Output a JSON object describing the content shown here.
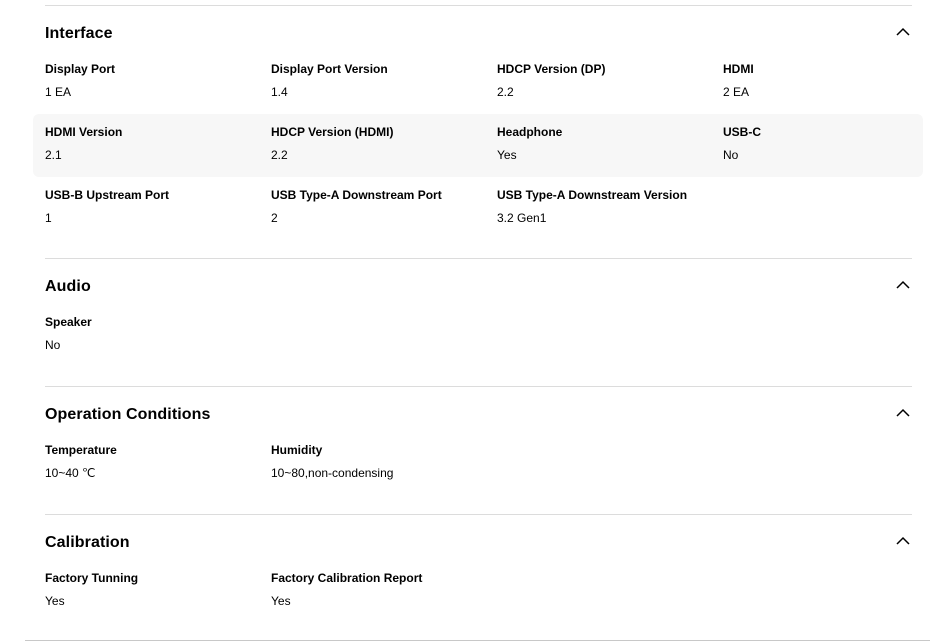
{
  "colors": {
    "divider": "#dcdcdc",
    "row_highlight": "#f7f7f7",
    "text": "#000000"
  },
  "sections": {
    "interface": {
      "title": "Interface",
      "toggle_icon": "chevron-up-icon",
      "rows": [
        [
          {
            "label": "Display Port",
            "value": "1 EA"
          },
          {
            "label": "Display Port Version",
            "value": "1.4"
          },
          {
            "label": "HDCP Version (DP)",
            "value": "2.2"
          },
          {
            "label": "HDMI",
            "value": "2 EA"
          }
        ],
        [
          {
            "label": "HDMI Version",
            "value": "2.1"
          },
          {
            "label": "HDCP Version (HDMI)",
            "value": "2.2"
          },
          {
            "label": "Headphone",
            "value": "Yes"
          },
          {
            "label": "USB-C",
            "value": "No"
          }
        ],
        [
          {
            "label": "USB-B Upstream Port",
            "value": "1"
          },
          {
            "label": "USB Type-A Downstream Port",
            "value": "2"
          },
          {
            "label": "USB Type-A Downstream Version",
            "value": "3.2 Gen1"
          }
        ]
      ]
    },
    "audio": {
      "title": "Audio",
      "toggle_icon": "chevron-up-icon",
      "rows": [
        [
          {
            "label": "Speaker",
            "value": "No"
          }
        ]
      ]
    },
    "operation": {
      "title": "Operation Conditions",
      "toggle_icon": "chevron-up-icon",
      "rows": [
        [
          {
            "label": "Temperature",
            "value": "10~40 ℃"
          },
          {
            "label": "Humidity",
            "value": "10~80,non-condensing"
          }
        ]
      ]
    },
    "calibration": {
      "title": "Calibration",
      "toggle_icon": "chevron-up-icon",
      "rows": [
        [
          {
            "label": "Factory Tunning",
            "value": "Yes"
          },
          {
            "label": "Factory Calibration Report",
            "value": "Yes"
          }
        ]
      ]
    }
  }
}
